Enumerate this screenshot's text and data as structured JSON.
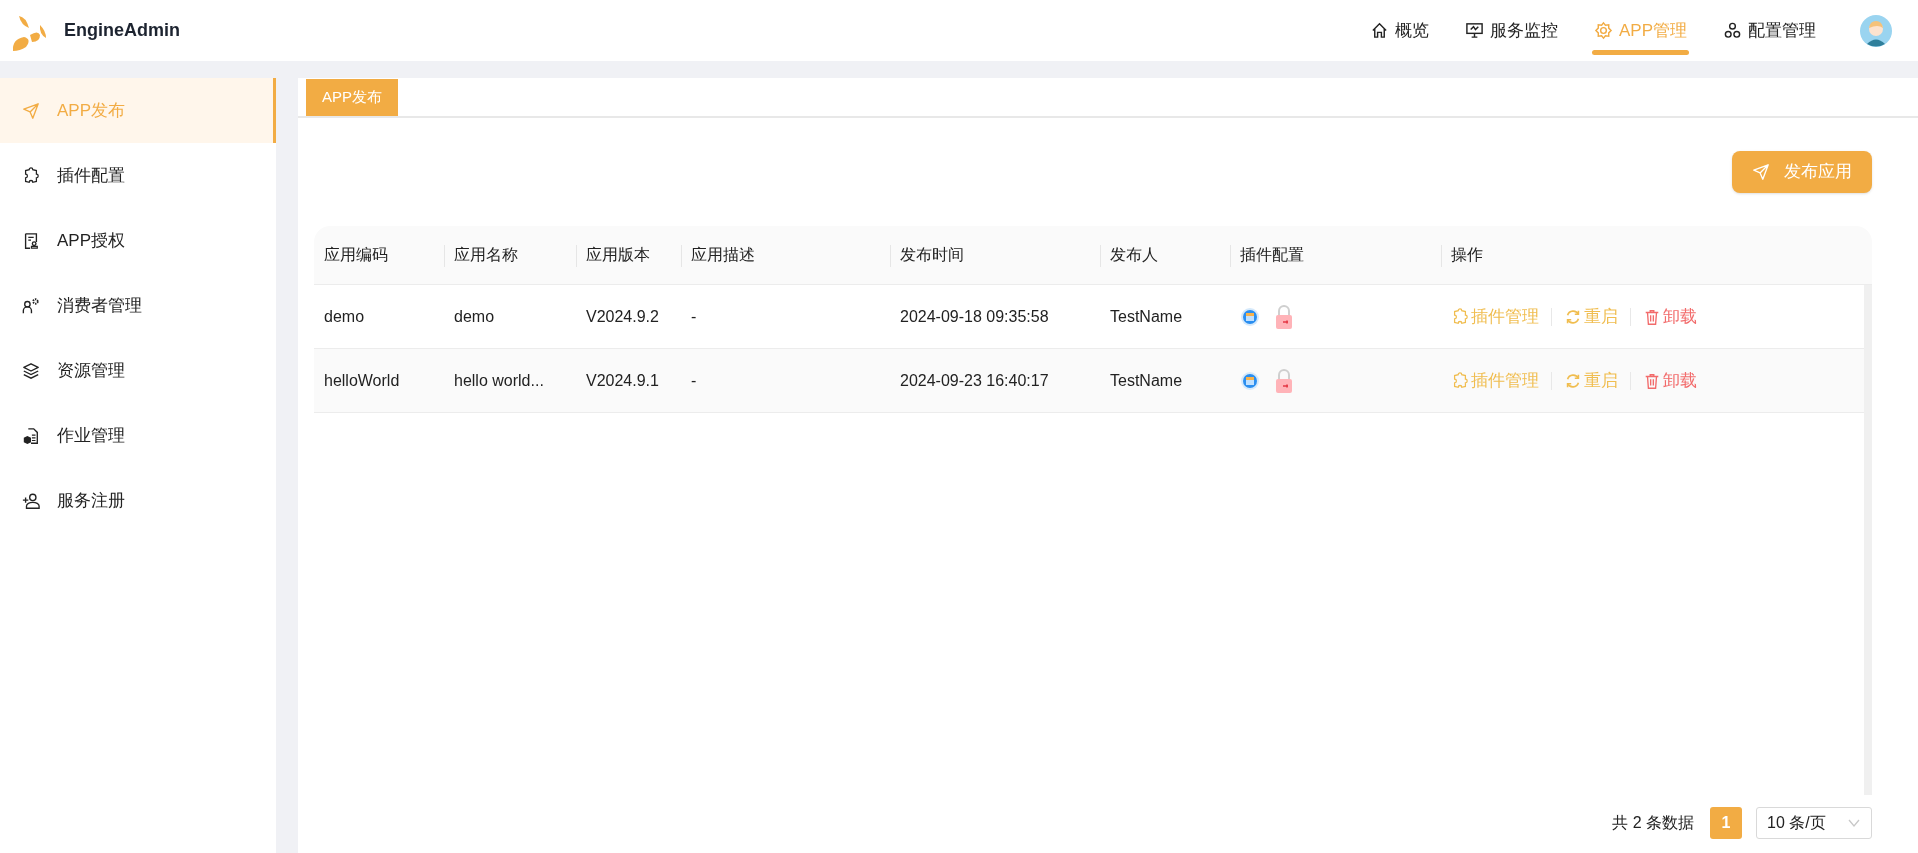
{
  "header": {
    "logo_text": "EngineAdmin",
    "nav": [
      {
        "label": "概览",
        "kind": "home",
        "selected": false
      },
      {
        "label": "服务监控",
        "kind": "monitor",
        "selected": false
      },
      {
        "label": "APP管理",
        "kind": "gear",
        "selected": true
      },
      {
        "label": "配置管理",
        "kind": "nodes",
        "selected": false
      }
    ]
  },
  "sidebar": {
    "items": [
      {
        "label": "APP发布",
        "kind": "send",
        "selected": true
      },
      {
        "label": "插件配置",
        "kind": "puzzle",
        "selected": false
      },
      {
        "label": "APP授权",
        "kind": "doc",
        "selected": false
      },
      {
        "label": "消费者管理",
        "kind": "user-gear",
        "selected": false
      },
      {
        "label": "资源管理",
        "kind": "layers",
        "selected": false
      },
      {
        "label": "作业管理",
        "kind": "job",
        "selected": false
      },
      {
        "label": "服务注册",
        "kind": "user-add",
        "selected": false
      }
    ]
  },
  "tabs": [
    {
      "label": "APP发布",
      "selected": true
    }
  ],
  "publish_button": "发布应用",
  "table": {
    "columns": [
      "应用编码",
      "应用名称",
      "应用版本",
      "应用描述",
      "发布时间",
      "发布人",
      "插件配置",
      "操作"
    ],
    "rows": [
      {
        "cells": [
          "demo",
          "demo",
          "V2024.9.2",
          "-",
          "2024-09-18 09:35:58",
          "TestName"
        ],
        "actions": [
          {
            "kind": "manage",
            "label": "插件管理"
          },
          {
            "kind": "restart",
            "label": "重启"
          },
          {
            "kind": "uninstall",
            "label": "卸载"
          }
        ]
      },
      {
        "cells": [
          "helloWorld",
          "hello world...",
          "V2024.9.1",
          "-",
          "2024-09-23 16:40:17",
          "TestName"
        ],
        "actions": [
          {
            "kind": "manage",
            "label": "插件管理"
          },
          {
            "kind": "restart",
            "label": "重启"
          },
          {
            "kind": "uninstall",
            "label": "卸载"
          }
        ]
      }
    ]
  },
  "pagination": {
    "total": "共 2 条数据",
    "pages": [
      {
        "label": "1",
        "selected": true
      }
    ],
    "page_size": "10 条/页"
  }
}
